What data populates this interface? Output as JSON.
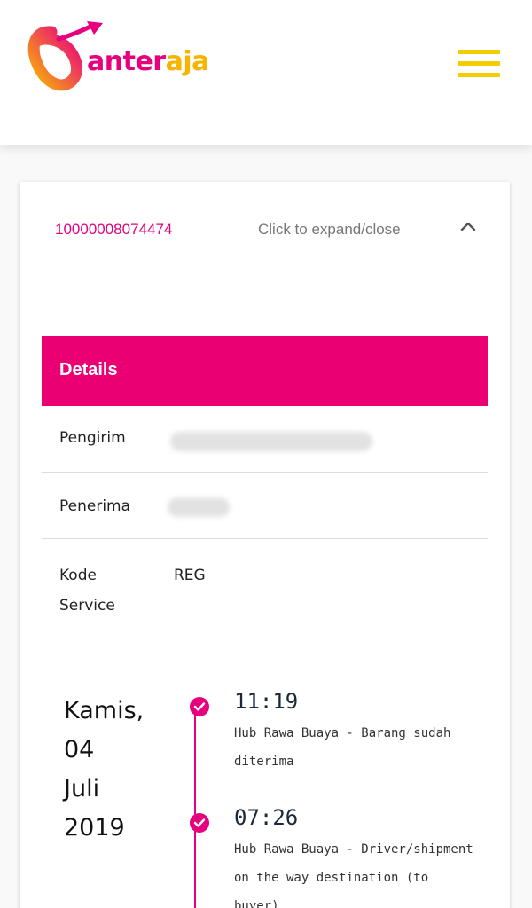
{
  "header": {
    "logo_text_1": "anter",
    "logo_text_2": "aja",
    "menu_icon": "hamburger-menu-icon",
    "colors": {
      "brand_pink": "#e6007e",
      "brand_yellow": "#f5cc00"
    }
  },
  "shipment": {
    "awb_number": "10000008074474",
    "expand_label": "Click to expand/close",
    "chevron_icon": "chevron-up-icon"
  },
  "details": {
    "title": "Details",
    "rows": [
      {
        "label": "Pengirim",
        "value": ""
      },
      {
        "label": "Penerima",
        "value": ""
      },
      {
        "label": "Kode Service",
        "value": "REG"
      }
    ]
  },
  "tracking": {
    "date": {
      "day": "Kamis,",
      "date": "04",
      "month": "Juli",
      "year": "2019"
    },
    "events": [
      {
        "time": "11:19",
        "description": "Hub Rawa Buaya - Barang sudah diterima",
        "icon": "check-circle-icon"
      },
      {
        "time": "07:26",
        "description": "Hub Rawa Buaya - Driver/shipment on the way destination (to buyer)",
        "icon": "check-circle-icon"
      }
    ]
  }
}
